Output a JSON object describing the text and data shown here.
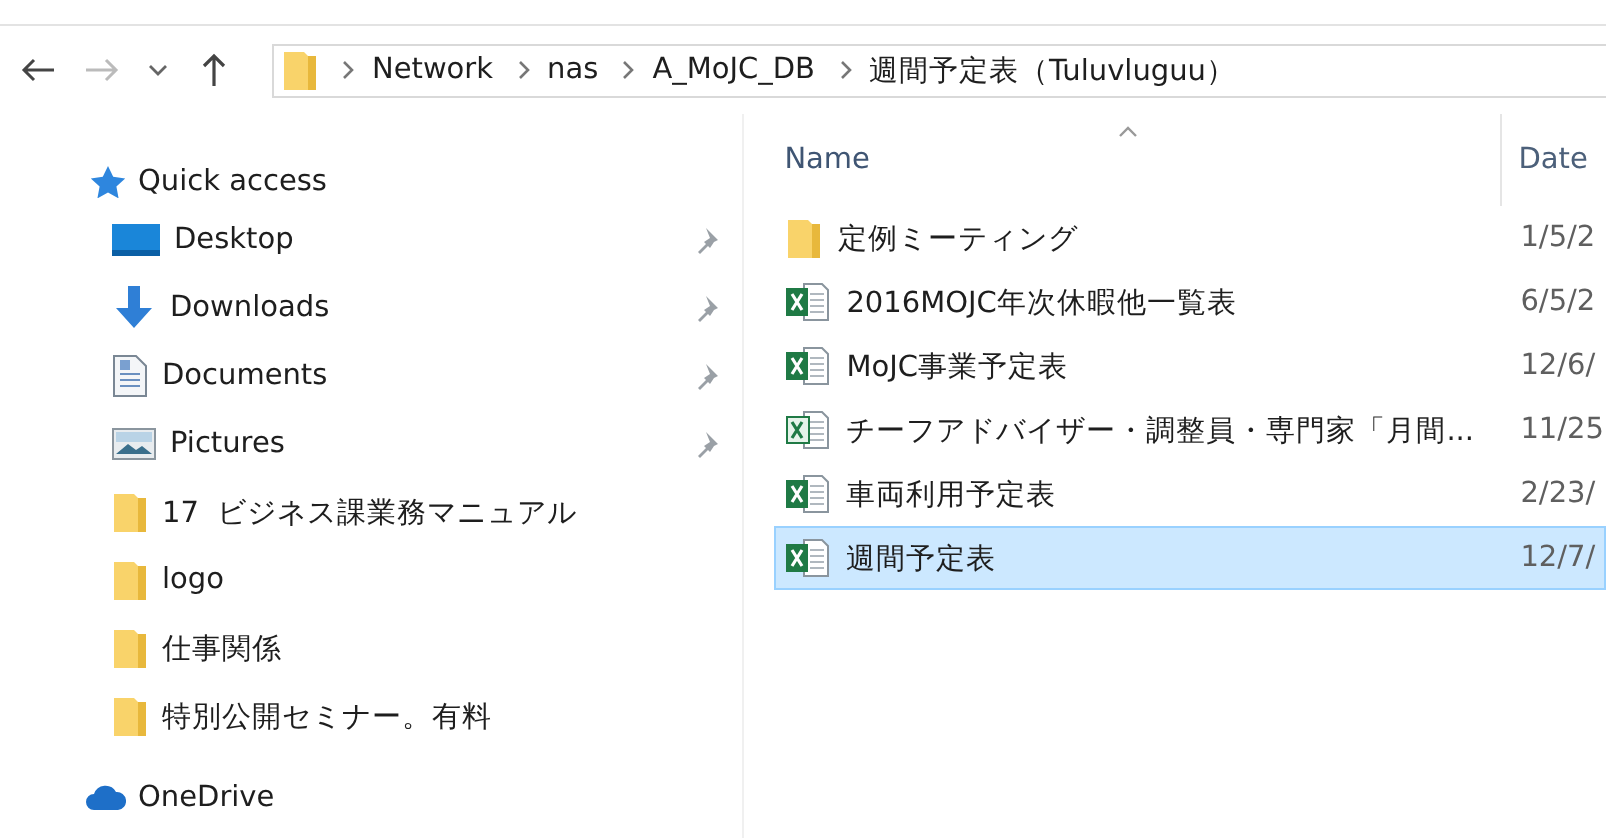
{
  "address_bar": {
    "segments": [
      "Network",
      "nas",
      "A_MoJC_DB",
      "週間予定表（Tuluvluguu）"
    ]
  },
  "sidebar": {
    "quick_access": {
      "label": "Quick access",
      "items": [
        {
          "label": "Desktop",
          "kind": "desktop",
          "pinned": true
        },
        {
          "label": "Downloads",
          "kind": "downloads",
          "pinned": true
        },
        {
          "label": "Documents",
          "kind": "documents",
          "pinned": true
        },
        {
          "label": "Pictures",
          "kind": "pictures",
          "pinned": true
        },
        {
          "label": "17  ビジネス課業務マニュアル",
          "kind": "folder",
          "pinned": false
        },
        {
          "label": "logo",
          "kind": "folder",
          "pinned": false
        },
        {
          "label": "仕事関係",
          "kind": "folder",
          "pinned": false
        },
        {
          "label": "特別公開セミナー。有料",
          "kind": "folder",
          "pinned": false
        }
      ]
    },
    "onedrive": {
      "label": "OneDrive"
    }
  },
  "file_list": {
    "columns": [
      {
        "label": "Name",
        "sorted": true
      },
      {
        "label": "Date",
        "sorted": false
      }
    ],
    "rows": [
      {
        "name": "定例ミーティング",
        "kind": "folder",
        "date": "1/5/2",
        "selected": false
      },
      {
        "name": "2016MOJC年次休暇他一覧表",
        "kind": "xlsx",
        "date": "6/5/2",
        "selected": false
      },
      {
        "name": "MoJC事業予定表",
        "kind": "xlsx",
        "date": "12/6/",
        "selected": false
      },
      {
        "name": "チーフアドバイザー・調整員・専門家「月間...",
        "kind": "xls",
        "date": "11/25",
        "selected": false
      },
      {
        "name": "車両利用予定表",
        "kind": "xlsx",
        "date": "2/23/",
        "selected": false
      },
      {
        "name": "週間予定表",
        "kind": "xlsx",
        "date": "12/7/",
        "selected": true
      }
    ]
  }
}
